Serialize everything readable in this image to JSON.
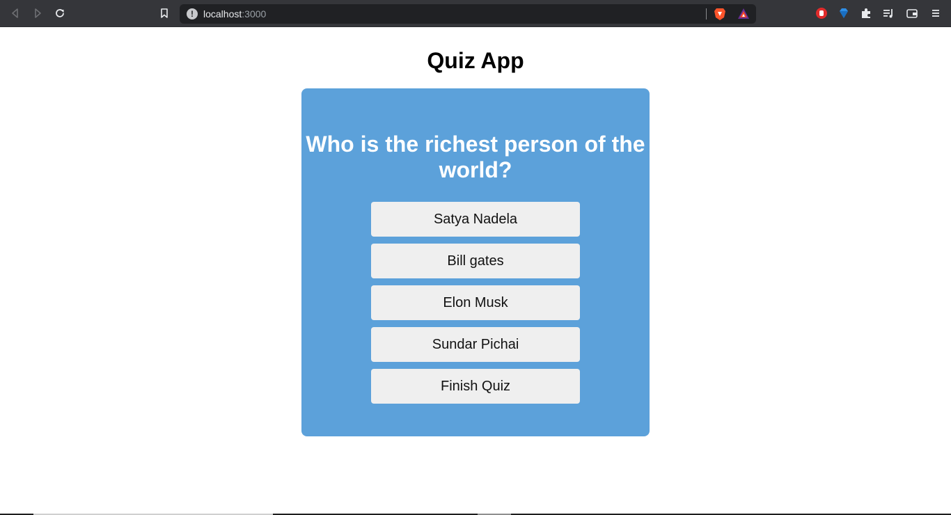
{
  "browser": {
    "url_host": "localhost",
    "url_port": ":3000",
    "icons": {
      "back": "back-icon",
      "forward": "forward-icon",
      "reload": "reload-icon",
      "bookmark": "bookmark-icon",
      "info": "info-icon",
      "brave_shields": "brave-shields-icon",
      "brave_rewards": "brave-rewards-icon",
      "ext_adblock": "adblock-icon",
      "ext_gem": "gem-icon",
      "extensions": "puzzle-icon",
      "playlist": "playlist-icon",
      "wallet": "wallet-icon",
      "menu": "menu-icon"
    },
    "info_glyph": "!"
  },
  "app": {
    "title": "Quiz App",
    "question": "Who is the richest person of the world?",
    "options": [
      {
        "label": "Satya Nadela"
      },
      {
        "label": "Bill gates"
      },
      {
        "label": "Elon Musk"
      },
      {
        "label": "Sundar Pichai"
      }
    ],
    "finish_label": "Finish Quiz"
  },
  "colors": {
    "card_bg": "#5ca1da",
    "button_bg": "#efefef",
    "toolbar_bg": "#35363a",
    "omnibox_bg": "#202124"
  }
}
